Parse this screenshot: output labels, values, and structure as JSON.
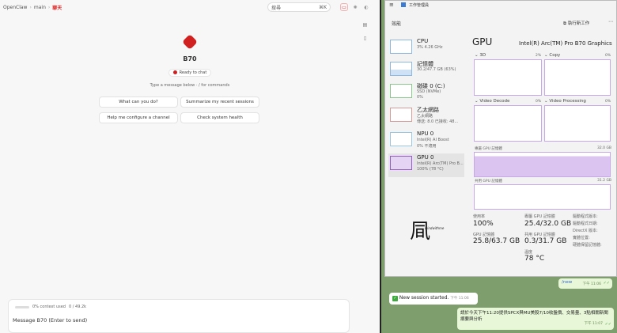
{
  "left": {
    "breadcrumb": [
      "OpenClaw",
      "main",
      "聊天"
    ],
    "search_label": "搜尋",
    "search_shortcut": "⌘K",
    "title": "B70",
    "status": "Ready to chat",
    "hint": "Type a message below · / for commands",
    "suggestions": [
      "What can you do?",
      "Summarize my recent sessions",
      "Help me configure a channel",
      "Check system health"
    ],
    "context_used": "0% context used",
    "context_tokens": "0 / 49.2k",
    "message_placeholder": "Message B70 (Enter to send)"
  },
  "task_manager": {
    "title": "工作管理員",
    "section": "效能",
    "new_task": "執行新工作",
    "list": [
      {
        "name": "CPU",
        "sub": "3%  4.26 GHz",
        "sub2": ""
      },
      {
        "name": "記憶體",
        "sub": "30.2/47.7 GB (63%)",
        "sub2": ""
      },
      {
        "name": "磁碟 0 (C:)",
        "sub": "SSD (NVMe)",
        "sub2": "0%"
      },
      {
        "name": "乙太網路",
        "sub": "乙太網路",
        "sub2": "傳送: 8.0 已接收: 48..."
      },
      {
        "name": "NPU 0",
        "sub": "Intel(R) AI Boost",
        "sub2": "0%  不適用"
      },
      {
        "name": "GPU 0",
        "sub": "Intel(R) Arc(TM) Pro B...",
        "sub2": "100%  (78 °C)"
      }
    ],
    "gpu_heading": "GPU",
    "gpu_model": "Intel(R) Arc(TM) Pro B70 Graphics",
    "panes": [
      {
        "label": "3D",
        "pct": "2%"
      },
      {
        "label": "Copy",
        "pct": "0%"
      },
      {
        "label": "Video Decode",
        "pct": "0%"
      },
      {
        "label": "Video Processing",
        "pct": "0%"
      }
    ],
    "dedicated_label": "專屬 GPU 記憶體",
    "dedicated_max": "32.0 GB",
    "shared_label": "共用 GPU 記憶體",
    "shared_max": "31.2 GB",
    "stats": {
      "usage_label": "使用率",
      "usage_value": "100%",
      "ded_label": "專屬 GPU 記憶體",
      "ded_value": "25.4/32.0 GB",
      "gpu_mem_label": "GPU 記憶體",
      "gpu_mem_value": "25.8/63.7 GB",
      "shared_label": "共用 GPU 記憶體",
      "shared_value": "0.3/31.7 GB",
      "temp_label": "溫度",
      "temp_value": "78 °C",
      "driver_version": "驅動程式版本:",
      "driver_date": "驅動程式日期:",
      "directx": "DirectX 版本:",
      "physical": "實體位置:",
      "reserved": "硬體保留記憶體:"
    },
    "signature": "凬",
    "signature_small": "windwithme"
  },
  "chat": {
    "new_cmd": "/new",
    "new_time": "下午 11:06",
    "session_started": "New session started.",
    "session_time": "下午 11:06",
    "message": "請於今天下午11:20提供SPCX與MU美股7/10收盤價、交易量、3點相關新聞摘要與分析",
    "message_time": "下午 11:07"
  },
  "colors": {
    "accent": "#d02020",
    "gpu_purple": "#9b59d0",
    "chat_bg": "#7f9e6d"
  }
}
